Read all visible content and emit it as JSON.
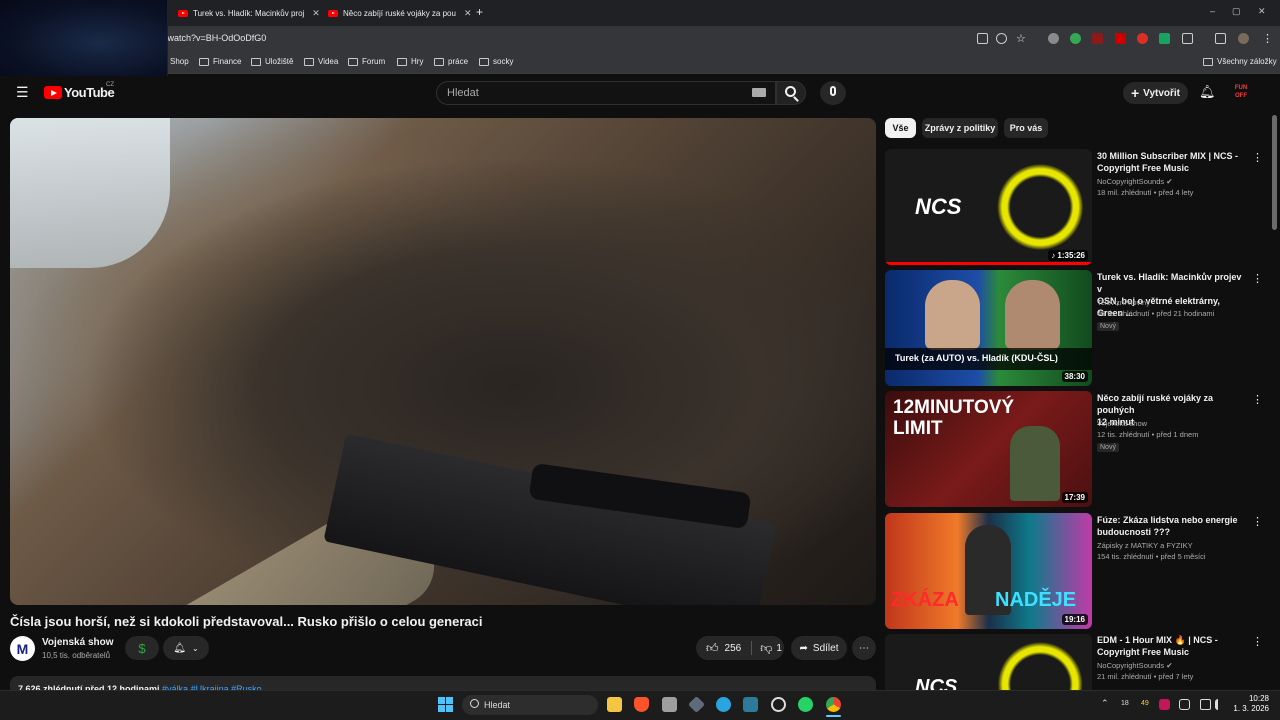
{
  "browser": {
    "tabs": [
      {
        "title": "Turek vs. Hladík: Macinkův proj"
      },
      {
        "title": "Něco zabíjí ruské vojáky za pou"
      }
    ],
    "new_tab": "+",
    "url": "n/watch?v=BH-OdOoDfG0",
    "bookmarks": [
      "Shop",
      "Finance",
      "Uložiště",
      "Videa",
      "Forum",
      "Hry",
      "práce",
      "socky"
    ],
    "all_bookmarks": "Všechny záložky",
    "window_controls": [
      "–",
      "▢",
      "✕"
    ]
  },
  "youtube": {
    "logo": "YouTube",
    "logo_region": "CZ",
    "search_placeholder": "Hledat",
    "create_label": "Vytvořit",
    "avatar_text": "FUN OFF"
  },
  "video": {
    "title": "Čísla jsou horší, než si kdokoli představoval... Rusko přišlo o celou generaci",
    "channel_initial": "M",
    "channel": "Vojenská show",
    "subscribers": "10,5 tis. odběratelů",
    "likes": "256",
    "dislikes": "1",
    "share_label": "Sdílet",
    "views_time": "7 626 zhlédnutí  před 12 hodinami",
    "tags": "#válka #Ukrajina #Rusko"
  },
  "filters": [
    "Vše",
    "Zprávy z politiky",
    "Pro vás"
  ],
  "recommended": [
    {
      "title_l1": "30 Million Subscriber MIX | NCS -",
      "title_l2": "Copyright Free Music",
      "channel": "NoCopyrightSounds ✔",
      "meta": "18 mil. zhlédnutí • před 4 lety",
      "duration": "♪ 1:35:26",
      "badge": "",
      "thumb_text": "NCS"
    },
    {
      "title_l1": "Turek vs. Hladík: Macinkův projev v",
      "title_l2": "OSN, boj o větrné elektrárny, Green ...",
      "channel": "Televizní noviny",
      "meta": "45 tis. zhlédnutí • před 21 hodinami",
      "duration": "38:30",
      "badge": "Nový",
      "thumb_text": "Turek (za AUTO) vs. Hladík (KDU-ČSL)"
    },
    {
      "title_l1": "Něco zabíjí ruské vojáky za pouhých",
      "title_l2": "12 minut",
      "channel": "Vojenská show",
      "meta": "12 tis. zhlédnutí • před 1 dnem",
      "duration": "17:39",
      "badge": "Nový",
      "thumb_text": "12MINUTOVÝ LIMIT"
    },
    {
      "title_l1": "Fúze: Zkáza lidstva nebo energie",
      "title_l2": "budoucnosti ???",
      "channel": "Zápisky z MATIKY a FYZIKY",
      "meta": "154 tis. zhlédnutí • před 5 měsíci",
      "duration": "19:16",
      "badge": "",
      "thumb_text_a": "ZKÁZA",
      "thumb_text_b": "NADĚJE"
    },
    {
      "title_l1": "EDM - 1 Hour MIX 🔥 | NCS -",
      "title_l2": "Copyright Free Music",
      "channel": "NoCopyrightSounds ✔",
      "meta": "21 mil. zhlédnutí • před 7 lety",
      "duration": "",
      "badge": "",
      "thumb_text": "NCS"
    }
  ],
  "taskbar": {
    "search": "Hledat",
    "tray_a": "18",
    "tray_b": "49",
    "time": "10:28",
    "date": "1. 3. 2026"
  },
  "colors": {
    "yt_red": "#ff0000",
    "link_blue": "#3ea6ff",
    "bg": "#0f0f0f"
  }
}
